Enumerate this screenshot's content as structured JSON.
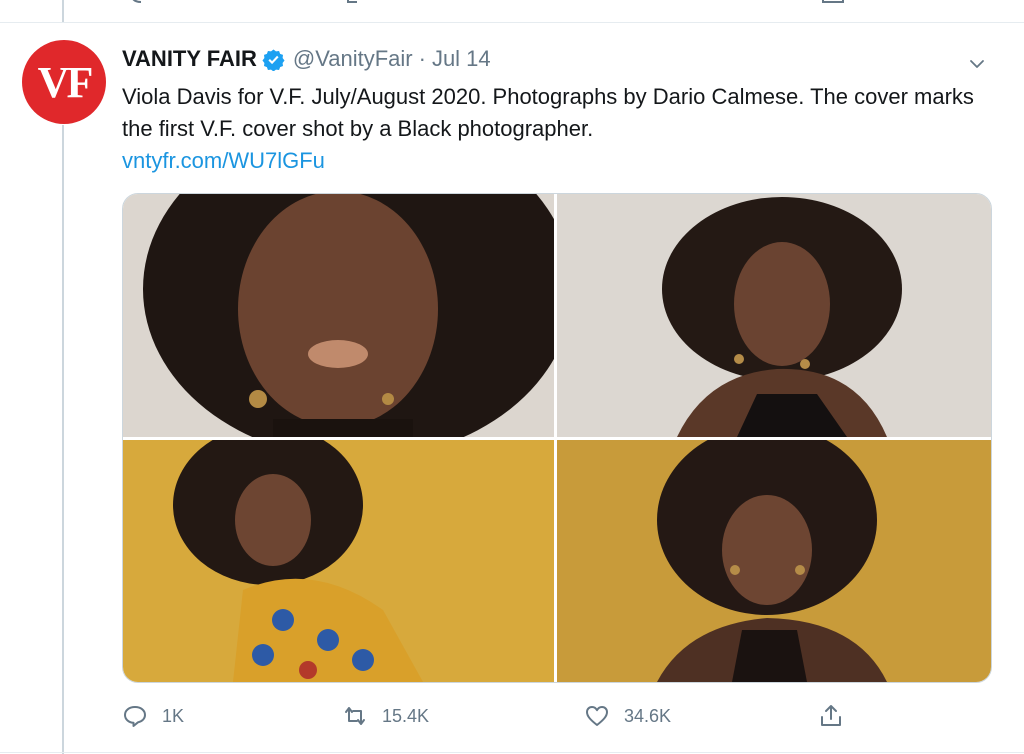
{
  "tweet": {
    "avatar_text": "VF",
    "display_name": "VANITY FAIR",
    "handle": "@VanityFair",
    "separator": "·",
    "date": "Jul 14",
    "text": "Viola Davis for V.F. July/August 2020. Photographs by Dario Calmese. The cover marks the first V.F. cover shot by a Black photographer.",
    "link": "vntyfr.com/WU7lGFu",
    "icons": {
      "verified": "verified-badge-icon",
      "menu": "chevron-down-icon",
      "reply": "reply-icon",
      "retweet": "retweet-icon",
      "like": "heart-icon",
      "share": "share-icon"
    },
    "actions": {
      "reply_count": "1K",
      "retweet_count": "15.4K",
      "like_count": "34.6K"
    }
  },
  "colors": {
    "accent": "#1b95e0",
    "brand": "#e0282b",
    "muted": "#657786",
    "border": "#ccd6dd"
  }
}
